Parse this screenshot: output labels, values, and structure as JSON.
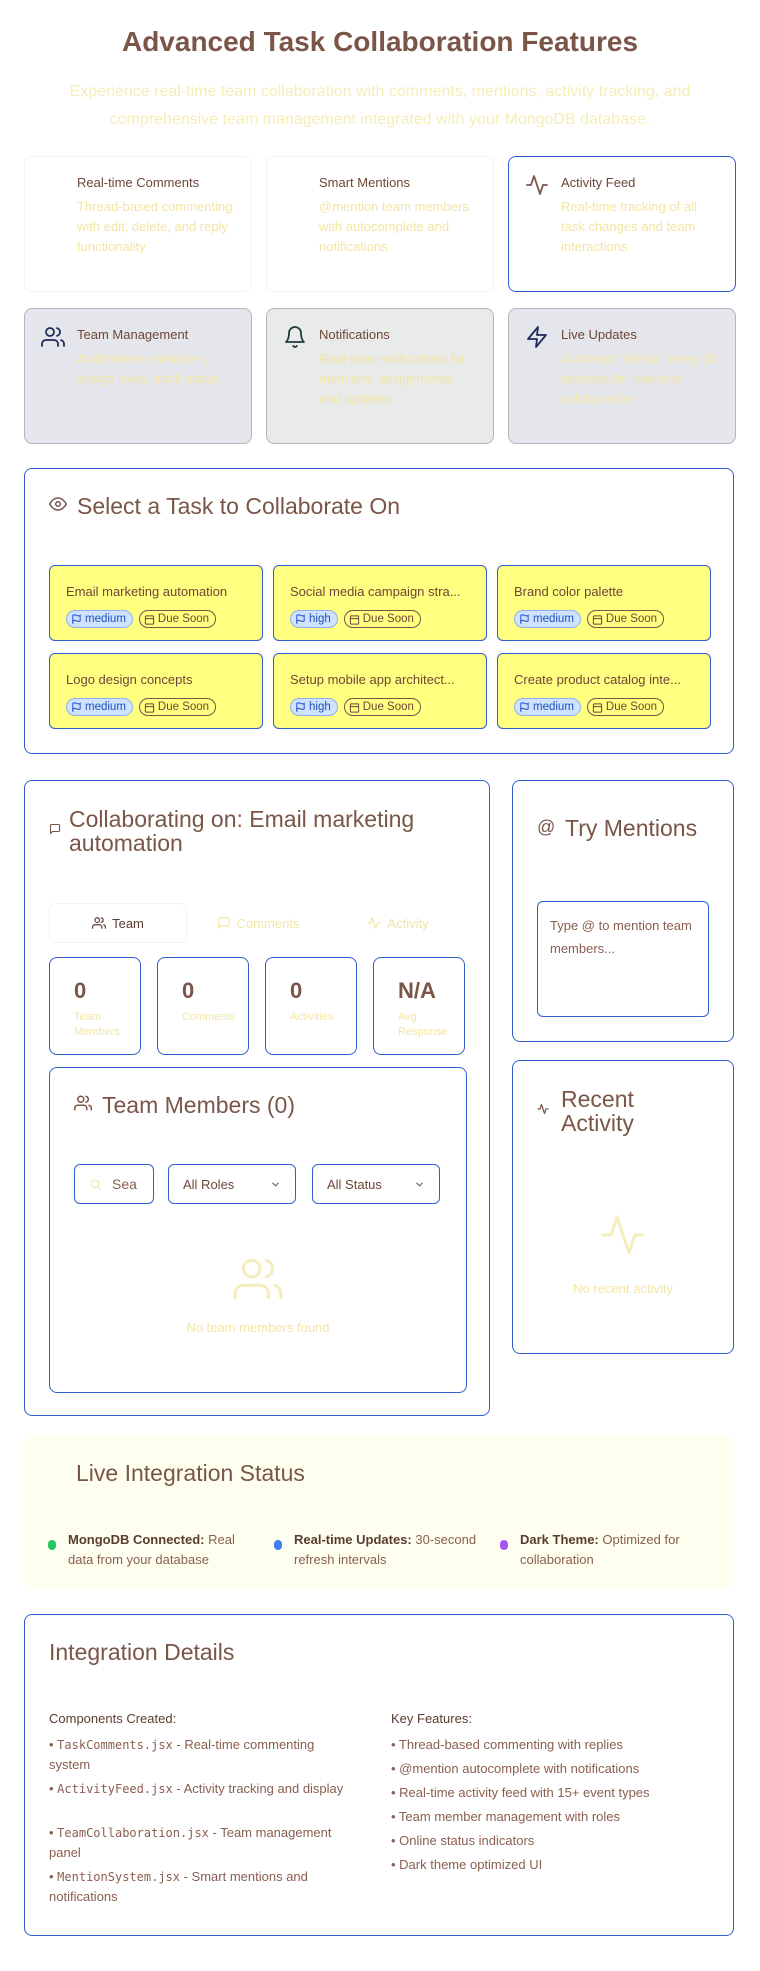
{
  "header": {
    "title": "Advanced Task Collaboration Features",
    "subtitle": "Experience real-time team collaboration with comments, mentions, activity tracking, and comprehensive team management integrated with your MongoDB database."
  },
  "features": [
    {
      "name": "Real-time Comments",
      "desc": "Thread-based commenting with edit, delete, and reply functionality",
      "icon": "none"
    },
    {
      "name": "Smart Mentions",
      "desc": "@mention team members with autocomplete and notifications",
      "icon": "none"
    },
    {
      "name": "Activity Feed",
      "desc": "Real-time tracking of all task changes and team interactions",
      "icon": "activity-icon"
    },
    {
      "name": "Team Management",
      "desc": "Add/remove members, assign roles, track status",
      "icon": "users-icon"
    },
    {
      "name": "Notifications",
      "desc": "Real-time notifications for mentions, assignments, and updates",
      "icon": "bell-icon"
    },
    {
      "name": "Live Updates",
      "desc": "Automatic refresh every 30 seconds for real-time collaboration",
      "icon": "zap-icon"
    }
  ],
  "task_select": {
    "title": "Select a Task to Collaborate On",
    "tasks": [
      {
        "name": "Email marketing automation",
        "priority": "medium",
        "due": "Due Soon"
      },
      {
        "name": "Social media campaign stra...",
        "priority": "high",
        "due": "Due Soon"
      },
      {
        "name": "Brand color palette",
        "priority": "medium",
        "due": "Due Soon"
      },
      {
        "name": "Logo design concepts",
        "priority": "medium",
        "due": "Due Soon"
      },
      {
        "name": "Setup mobile app architect...",
        "priority": "high",
        "due": "Due Soon"
      },
      {
        "name": "Create product catalog inte...",
        "priority": "medium",
        "due": "Due Soon"
      }
    ]
  },
  "collab": {
    "title": "Collaborating on: Email marketing automation",
    "tabs": {
      "team": "Team",
      "comments": "Comments",
      "activity": "Activity"
    },
    "stats": [
      {
        "value": "0",
        "label": "Team Members"
      },
      {
        "value": "0",
        "label": "Comments"
      },
      {
        "value": "0",
        "label": "Activities"
      },
      {
        "value": "N/A",
        "label": "Avg Response"
      }
    ],
    "team_panel": {
      "title": "Team Members (0)",
      "search_placeholder": "Sea",
      "roles_select": "All Roles",
      "status_select": "All Status",
      "empty": "No team members found"
    }
  },
  "mentions": {
    "title": "Try Mentions",
    "placeholder": "Type @ to mention team members..."
  },
  "recent": {
    "title": "Recent Activity",
    "empty": "No recent activity"
  },
  "live_status": {
    "title": "Live Integration Status",
    "items": [
      {
        "label": "MongoDB Connected:",
        "text": " Real data from your database",
        "color": "#22c55e"
      },
      {
        "label": "Real-time Updates:",
        "text": " 30-second refresh intervals",
        "color": "#3b82f6"
      },
      {
        "label": "Dark Theme:",
        "text": " Optimized for collaboration",
        "color": "#a855f7"
      }
    ]
  },
  "details": {
    "title": "Integration Details",
    "components_heading": "Components Created:",
    "components": [
      {
        "file": "TaskComments.jsx",
        "desc": " - Real-time commenting system"
      },
      {
        "file": "ActivityFeed.jsx",
        "desc": " - Activity tracking and display"
      },
      {
        "file": "TeamCollaboration.jsx",
        "desc": " - Team management panel"
      },
      {
        "file": "MentionSystem.jsx",
        "desc": " - Smart mentions and notifications"
      }
    ],
    "features_heading": "Key Features:",
    "features": [
      "• Thread-based commenting with replies",
      "• @mention autocomplete with notifications",
      "• Real-time activity feed with 15+ event types",
      "• Team member management with roles",
      "• Online status indicators",
      "• Dark theme optimized UI"
    ]
  }
}
